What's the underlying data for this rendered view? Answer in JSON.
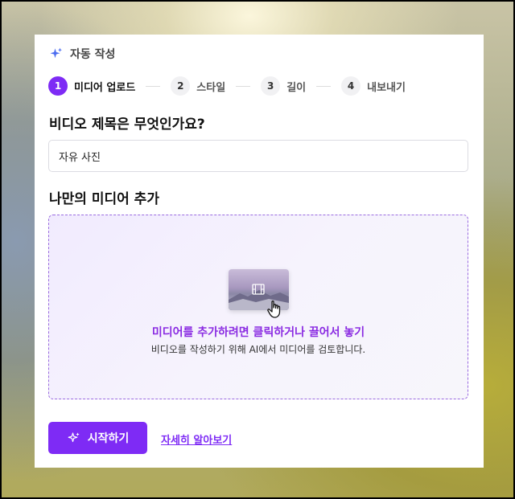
{
  "header": {
    "title": "자동 작성",
    "icon": "sparkle-icon"
  },
  "steps": [
    {
      "num": "1",
      "label": "미디어 업로드",
      "active": true
    },
    {
      "num": "2",
      "label": "스타일"
    },
    {
      "num": "3",
      "label": "길이"
    },
    {
      "num": "4",
      "label": "내보내기"
    }
  ],
  "question_title": "비디오 제목은 무엇인가요?",
  "title_input": {
    "value": "자유 사진"
  },
  "media_section_title": "나만의 미디어 추가",
  "dropzone": {
    "primary_text": "미디어를 추가하려면 클릭하거나 끌어서 놓기",
    "secondary_text": "비디오를 작성하기 위해 AI에서 미디어를 검토합니다."
  },
  "actions": {
    "start_label": "시작하기",
    "learn_more_label": "자세히 알아보기"
  },
  "colors": {
    "accent": "#7e2bf5",
    "accent_text": "#8a2be2"
  }
}
